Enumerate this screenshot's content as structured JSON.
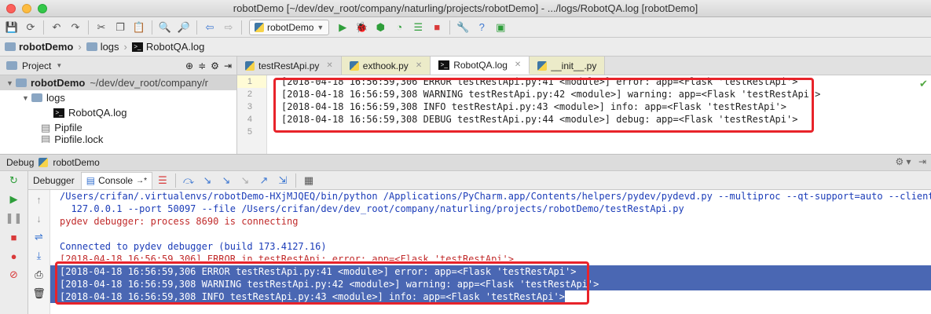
{
  "window": {
    "title": "robotDemo [~/dev/dev_root/company/naturling/projects/robotDemo] - .../logs/RobotQA.log [robotDemo]"
  },
  "toolbar": {
    "run_config": "robotDemo"
  },
  "breadcrumb": [
    "robotDemo",
    "logs",
    "RobotQA.log"
  ],
  "project": {
    "header": "Project",
    "tree": [
      {
        "label": "robotDemo",
        "detail": "~/dev/dev_root/company/r",
        "level": 0
      },
      {
        "label": "logs",
        "level": 1
      },
      {
        "label": "RobotQA.log",
        "level": 2
      },
      {
        "label": "Pipfile",
        "level": 1
      },
      {
        "label": "Pipfile.lock",
        "level": 1
      }
    ]
  },
  "editor": {
    "tabs": [
      "testRestApi.py",
      "exthook.py",
      "RobotQA.log",
      "__init__.py"
    ],
    "active_tab": "RobotQA.log",
    "line_numbers": [
      "1",
      "2",
      "3",
      "4",
      "5"
    ],
    "lines": [
      "[2018-04-18 16:56:59,306 ERROR testRestApi.py:41 <module>] error: app=<Flask 'testRestApi'>",
      "[2018-04-18 16:56:59,308 WARNING testRestApi.py:42 <module>] warning: app=<Flask 'testRestApi'>",
      "[2018-04-18 16:56:59,308 INFO testRestApi.py:43 <module>] info: app=<Flask 'testRestApi'>",
      "[2018-04-18 16:56:59,308 DEBUG testRestApi.py:44 <module>] debug: app=<Flask 'testRestApi'>",
      ""
    ]
  },
  "debug": {
    "label": "Debug",
    "config": "robotDemo",
    "tabs": [
      "Debugger",
      "Console"
    ],
    "active_tab": "Console",
    "console": [
      "/Users/crifan/.virtualenvs/robotDemo-HXjMJQEQ/bin/python /Applications/PyCharm.app/Contents/helpers/pydev/pydevd.py --multiproc --qt-support=auto --client",
      "  127.0.0.1 --port 50097 --file /Users/crifan/dev/dev_root/company/naturling/projects/robotDemo/testRestApi.py",
      "pydev debugger: process 8690 is connecting",
      "",
      "Connected to pydev debugger (build 173.4127.16)",
      "[2018-04-18 16:56:59,306] ERROR in testRestApi: error: app=<Flask 'testRestApi'>",
      "[2018-04-18 16:56:59,306 ERROR testRestApi.py:41 <module>] error: app=<Flask 'testRestApi'>",
      "[2018-04-18 16:56:59,308 WARNING testRestApi.py:42 <module>] warning: app=<Flask 'testRestApi'>",
      "[2018-04-18 16:56:59,308 INFO testRestApi.py:43 <module>] info: app=<Flask 'testRestApi'>"
    ]
  },
  "colors": {
    "highlight_box": "#e8232a",
    "selection": "#4a67b3",
    "console_blue": "#1b3cb8",
    "console_red": "#c12b2b"
  }
}
